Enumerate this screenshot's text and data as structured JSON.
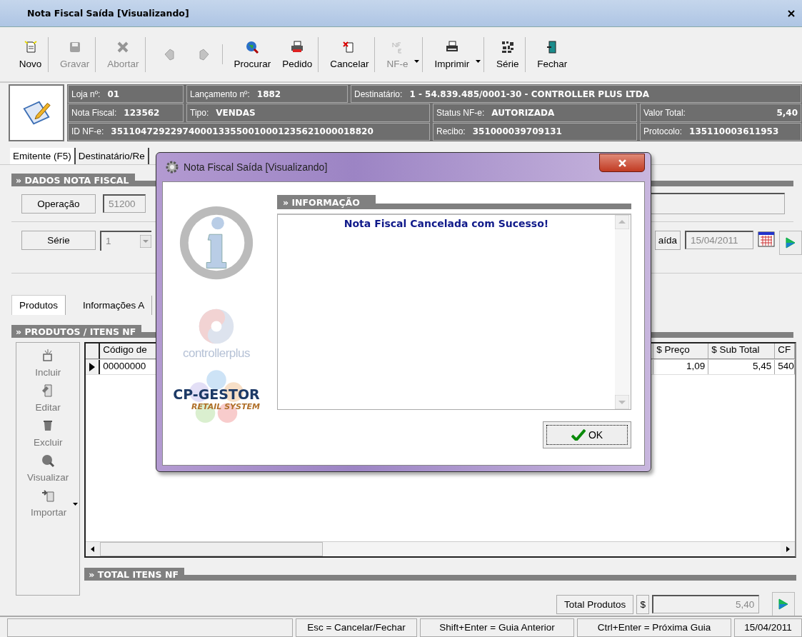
{
  "window": {
    "title": "Nota Fiscal Saída [Visualizando]"
  },
  "toolbar": [
    {
      "kind": "new",
      "label": "Novo",
      "disabled": false,
      "separator_after": true
    },
    {
      "kind": "save",
      "label": "Gravar",
      "disabled": true,
      "separator_after": true
    },
    {
      "kind": "abort",
      "label": "Abortar",
      "disabled": true,
      "separator_after": true
    },
    {
      "kind": "prev",
      "disabled": true,
      "separator_after": false
    },
    {
      "kind": "next",
      "disabled": true,
      "separator_after": true
    },
    {
      "kind": "search",
      "label": "Procurar",
      "disabled": false,
      "separator_after": false
    },
    {
      "kind": "order",
      "label": "Pedido",
      "disabled": false,
      "separator_after": true
    },
    {
      "kind": "cancel",
      "label": "Cancelar",
      "disabled": false,
      "separator_after": true
    },
    {
      "kind": "nfe",
      "label": "NF-e",
      "disabled": true,
      "dropdown": true,
      "separator_after": true
    },
    {
      "kind": "print",
      "label": "Imprimir",
      "disabled": false,
      "dropdown": true,
      "separator_after": true
    },
    {
      "kind": "serie",
      "label": "Série",
      "disabled": false,
      "separator_after": true
    },
    {
      "kind": "exit",
      "label": "Fechar",
      "disabled": false,
      "separator_after": false
    }
  ],
  "header": [
    [
      {
        "label": "Loja nº:",
        "value": "01"
      },
      {
        "label": "Lançamento nº:",
        "value": "1882"
      },
      {
        "label": "Destinatário:",
        "value": "1 - 54.839.485/0001-30 - CONTROLLER PLUS  LTDA"
      }
    ],
    [
      {
        "label": "Nota Fiscal:",
        "value": "123562"
      },
      {
        "label": "Tipo:",
        "value": "VENDAS"
      },
      {
        "label": "Status NF-e:",
        "value": "AUTORIZADA"
      },
      {
        "label": "Valor Total:",
        "value": "5,40"
      }
    ],
    [
      {
        "label": "ID NF-e:",
        "value": "35110472922974000133550010001235621000018820"
      },
      {
        "label": "Recibo:",
        "value": "351000039709131"
      },
      {
        "label": "Protocolo:",
        "value": "135110003611953"
      }
    ]
  ],
  "tabs": [
    {
      "label": "Emitente (F5)",
      "selected": true
    },
    {
      "label": "Destinatário/Re",
      "selected": false
    }
  ],
  "dados": {
    "title": "» DADOS NOTA FISCAL",
    "operacao": {
      "label": "Operação",
      "value": "51200"
    },
    "serie": {
      "label": "Série",
      "value": "1"
    },
    "saida": {
      "label": "aída",
      "value": "15/04/2011"
    }
  },
  "sub_tabs": [
    {
      "label": "Produtos",
      "selected": true
    },
    {
      "label": "Informações A",
      "selected": false
    }
  ],
  "produtos": {
    "title": "» PRODUTOS / ITENS NF",
    "actions": [
      {
        "kind": "add",
        "label": "Incluir"
      },
      {
        "kind": "edit",
        "label": "Editar"
      },
      {
        "kind": "delete",
        "label": "Excluir"
      },
      {
        "kind": "view",
        "label": "Visualizar"
      },
      {
        "kind": "import",
        "label": "Importar",
        "dropdown": true
      }
    ],
    "columns": [
      "Código de",
      "$ Preço",
      "$ Sub Total",
      "CF"
    ],
    "rows": [
      {
        "current": true,
        "cells": [
          "00000000",
          "1,09",
          "5,45",
          "540"
        ]
      }
    ]
  },
  "total": {
    "title": "» TOTAL ITENS NF",
    "label": "Total Produtos",
    "currency": "$",
    "value": "5,40"
  },
  "status_bar": [
    "Esc = Cancelar/Fechar",
    "Shift+Enter = Guia Anterior",
    "Ctrl+Enter = Próxima Guia",
    "15/04/2011"
  ],
  "dialog": {
    "title": "Nota Fiscal Saída [Visualizando]",
    "brand": "controllerplus",
    "product": "CP-GESTOR",
    "tagline": "RETAIL SYSTEM",
    "section_title": "» INFORMAÇÃO",
    "message": "Nota Fiscal Cancelada com Sucesso!",
    "button": "OK"
  }
}
